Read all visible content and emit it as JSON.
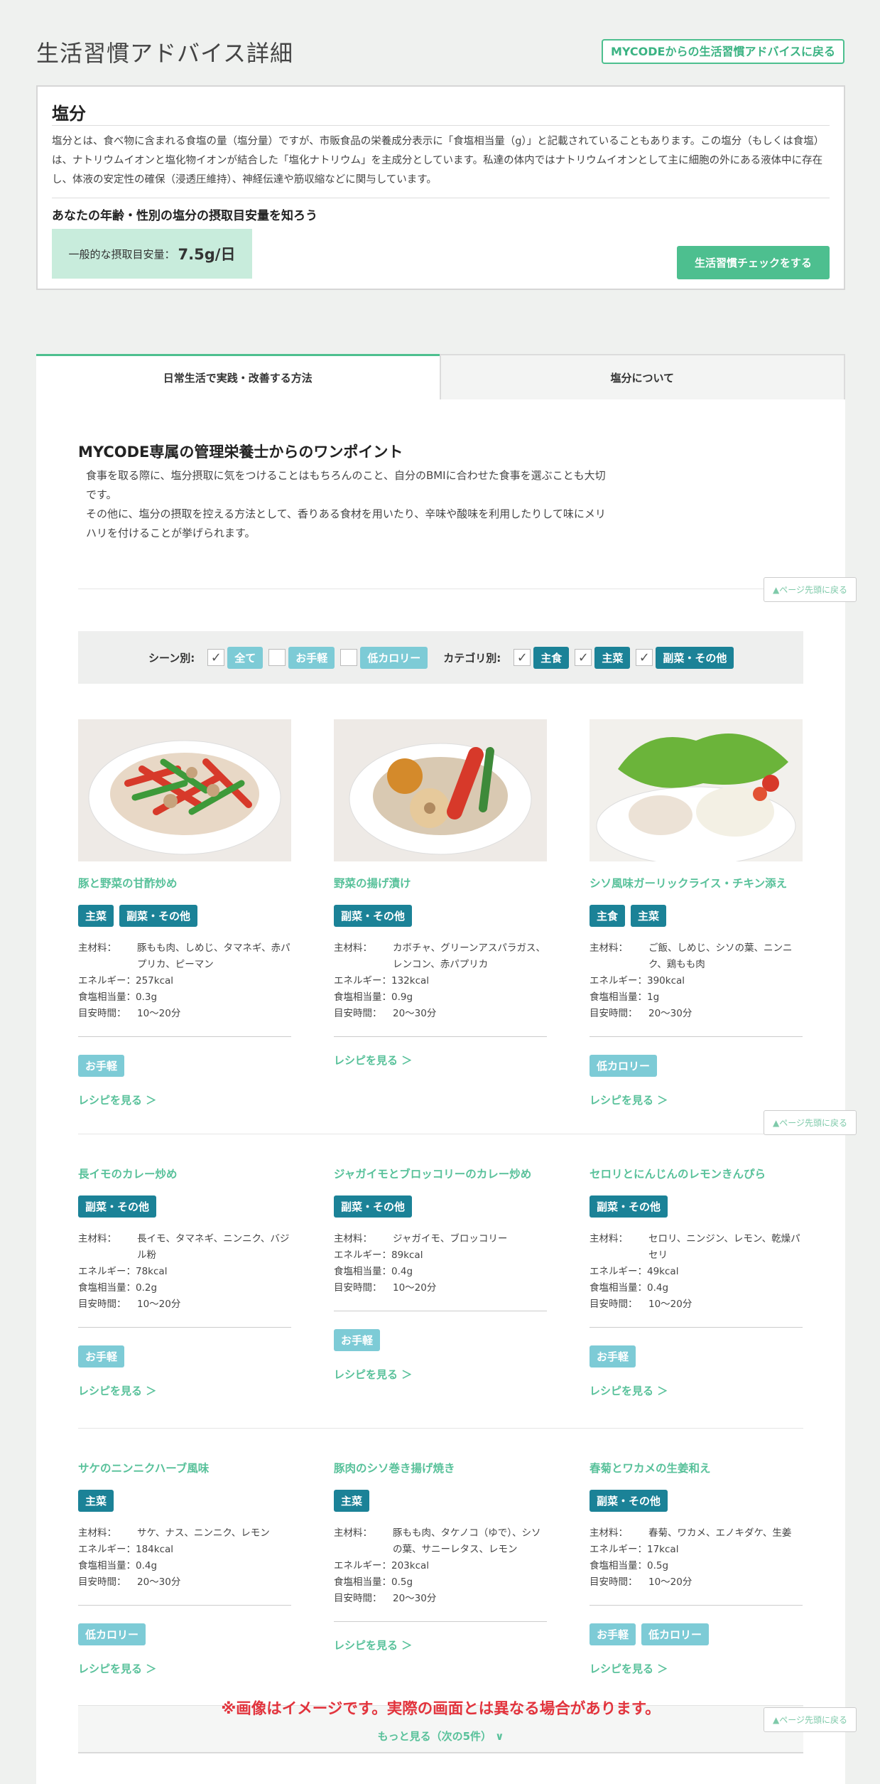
{
  "header": {
    "title": "生活習慣アドバイス詳細",
    "back_label": "MYCODEからの生活習慣アドバイスに戻る"
  },
  "salt": {
    "title": "塩分",
    "description": "塩分とは、食べ物に含まれる食塩の量（塩分量）ですが、市販食品の栄養成分表示に「食塩相当量（g）」と記載されていることもあります。この塩分（もしくは食塩）は、ナトリウムイオンと塩化物イオンが結合した「塩化ナトリウム」を主成分としています。私達の体内ではナトリウムイオンとして主に細胞の外にある液体中に存在し、体液の安定性の確保（浸透圧維持）、神経伝達や筋収縮などに関与しています。",
    "intake_heading": "あなたの年齢・性別の塩分の摂取目安量を知ろう",
    "intake_label": "一般的な摂取目安量：",
    "intake_value": "7.5g/日",
    "check_button": "生活習慣チェックをする"
  },
  "tabs": [
    {
      "label": "日常生活で実践・改善する方法"
    },
    {
      "label": "塩分について"
    }
  ],
  "onepoint": {
    "title": "MYCODE専属の管理栄養士からのワンポイント",
    "line1": "食事を取る際に、塩分摂取に気をつけることはもちろんのこと、自分のBMIに合わせた食事を選ぶことも大切です。",
    "line2": "その他に、塩分の摂取を控える方法として、香りある食材を用いたり、辛味や酸味を利用したりして味にメリハリを付けることが挙げられます。"
  },
  "page_top_label": "▲ページ先頭に戻る",
  "filter": {
    "scene_label": "シーン別:",
    "category_label": "カテゴリ別:",
    "scenes": [
      {
        "label": "全て",
        "checked": true
      },
      {
        "label": "お手軽",
        "checked": false
      },
      {
        "label": "低カロリー",
        "checked": false
      }
    ],
    "categories": [
      {
        "label": "主食",
        "checked": true
      },
      {
        "label": "主菜",
        "checked": true
      },
      {
        "label": "副菜・その他",
        "checked": true
      }
    ]
  },
  "labels": {
    "ingredients": "主材料：",
    "energy": "エネルギー：",
    "salt": "食塩相当量：",
    "time": "目安時間：",
    "recipe_link": "レシピを見る ＞"
  },
  "recipes": [
    {
      "title": "豚と野菜の甘酢炒め",
      "categories": [
        "主菜",
        "副菜・その他"
      ],
      "ingredients": "豚もも肉、しめじ、タマネギ、赤パプリカ、ピーマン",
      "energy": "257kcal",
      "salt": "0.3g",
      "time": "10〜20分",
      "scenes": [
        "お手軽"
      ]
    },
    {
      "title": "野菜の揚げ漬け",
      "categories": [
        "副菜・その他"
      ],
      "ingredients": "カボチャ、グリーンアスパラガス、レンコン、赤パプリカ",
      "energy": "132kcal",
      "salt": "0.9g",
      "time": "20〜30分",
      "scenes": []
    },
    {
      "title": "シソ風味ガーリックライス・チキン添え",
      "categories": [
        "主食",
        "主菜"
      ],
      "ingredients": "ご飯、しめじ、シソの葉、ニンニク、鶏もも肉",
      "energy": "390kcal",
      "salt": "1g",
      "time": "20〜30分",
      "scenes": [
        "低カロリー"
      ]
    },
    {
      "title": "長イモのカレー炒め",
      "categories": [
        "副菜・その他"
      ],
      "ingredients": "長イモ、タマネギ、ニンニク、バジル粉",
      "energy": "78kcal",
      "salt": "0.2g",
      "time": "10〜20分",
      "scenes": [
        "お手軽"
      ]
    },
    {
      "title": "ジャガイモとブロッコリーのカレー炒め",
      "categories": [
        "副菜・その他"
      ],
      "ingredients": "ジャガイモ、ブロッコリー",
      "energy": "89kcal",
      "salt": "0.4g",
      "time": "10〜20分",
      "scenes": [
        "お手軽"
      ]
    },
    {
      "title": "セロリとにんじんのレモンきんぴら",
      "categories": [
        "副菜・その他"
      ],
      "ingredients": "セロリ、ニンジン、レモン、乾燥パセリ",
      "energy": "49kcal",
      "salt": "0.4g",
      "time": "10〜20分",
      "scenes": [
        "お手軽"
      ]
    },
    {
      "title": "サケのニンニクハーブ風味",
      "categories": [
        "主菜"
      ],
      "ingredients": "サケ、ナス、ニンニク、レモン",
      "energy": "184kcal",
      "salt": "0.4g",
      "time": "20〜30分",
      "scenes": [
        "低カロリー"
      ]
    },
    {
      "title": "豚肉のシソ巻き揚げ焼き",
      "categories": [
        "主菜"
      ],
      "ingredients": "豚もも肉、タケノコ（ゆで）、シソの葉、サニーレタス、レモン",
      "energy": "203kcal",
      "salt": "0.5g",
      "time": "20〜30分",
      "scenes": []
    },
    {
      "title": "春菊とワカメの生姜和え",
      "categories": [
        "副菜・その他"
      ],
      "ingredients": "春菊、ワカメ、エノキダケ、生姜",
      "energy": "17kcal",
      "salt": "0.5g",
      "time": "10〜20分",
      "scenes": [
        "お手軽",
        "低カロリー"
      ]
    }
  ],
  "disclaimer": "※画像はイメージです。実際の画面とは異なる場合があります。",
  "more_label": "もっと見る（次の5件） ∨"
}
